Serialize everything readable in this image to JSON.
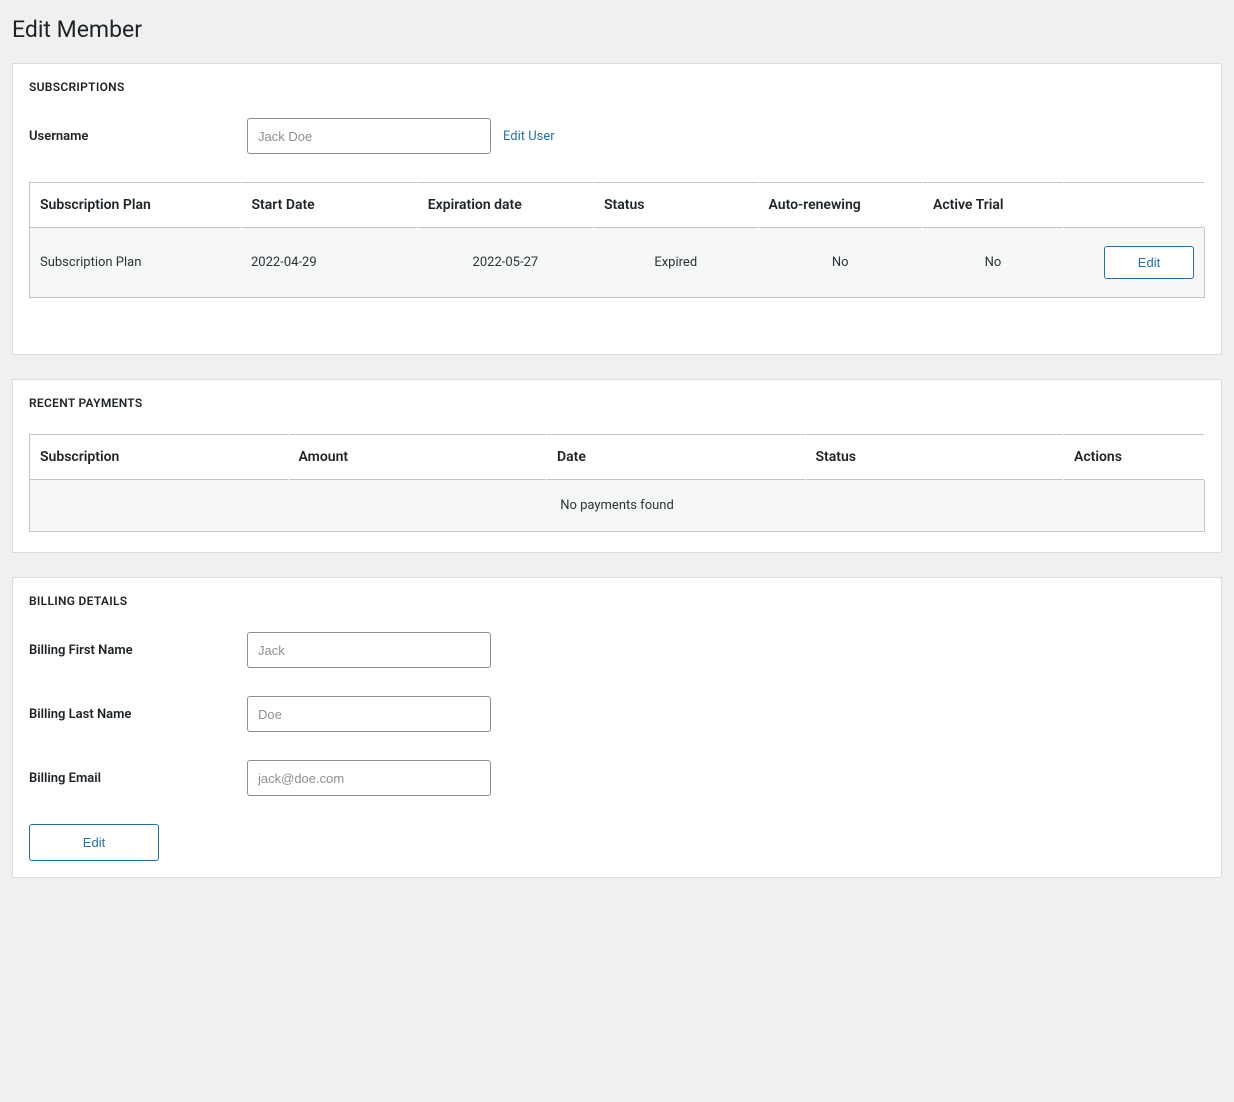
{
  "page_title": "Edit Member",
  "subscriptions": {
    "heading": "SUBSCRIPTIONS",
    "username_label": "Username",
    "username_value": "Jack Doe",
    "edit_user_link": "Edit User",
    "columns": {
      "plan": "Subscription Plan",
      "start": "Start Date",
      "expiration": "Expiration date",
      "status": "Status",
      "auto": "Auto-renewing",
      "trial": "Active Trial"
    },
    "row": {
      "plan": "Subscription Plan",
      "start": "2022-04-29",
      "expiration": "2022-05-27",
      "status": "Expired",
      "auto": "No",
      "trial": "No",
      "edit_label": "Edit"
    }
  },
  "payments": {
    "heading": "RECENT PAYMENTS",
    "columns": {
      "subscription": "Subscription",
      "amount": "Amount",
      "date": "Date",
      "status": "Status",
      "actions": "Actions"
    },
    "empty_message": "No payments found"
  },
  "billing": {
    "heading": "BILLING DETAILS",
    "first_name_label": "Billing First Name",
    "first_name_value": "Jack",
    "last_name_label": "Billing Last Name",
    "last_name_value": "Doe",
    "email_label": "Billing Email",
    "email_value": "jack@doe.com",
    "edit_label": "Edit"
  }
}
